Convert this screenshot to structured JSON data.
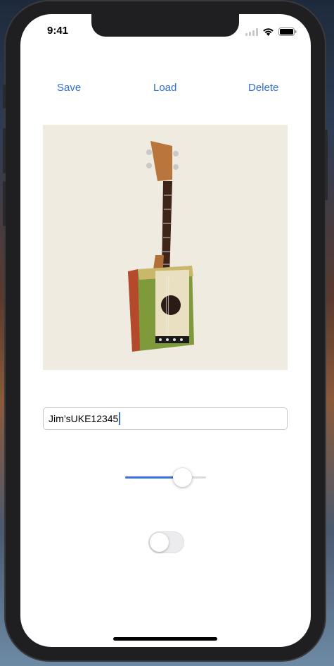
{
  "status_bar": {
    "time": "9:41"
  },
  "toolbar": {
    "save_label": "Save",
    "load_label": "Load",
    "delete_label": "Delete"
  },
  "name_field": {
    "value": "Jim’sUKE12345"
  },
  "slider": {
    "value": 0.7
  },
  "toggle": {
    "on": false
  },
  "colors": {
    "accent": "#2f6fd6",
    "slider_fill": "#3a6fe0",
    "photo_bg": "#efebe0"
  },
  "icons": [
    "cellular-signal-icon",
    "wifi-icon",
    "battery-icon"
  ],
  "photo": {
    "subject": "cigar-box-ukulele"
  }
}
